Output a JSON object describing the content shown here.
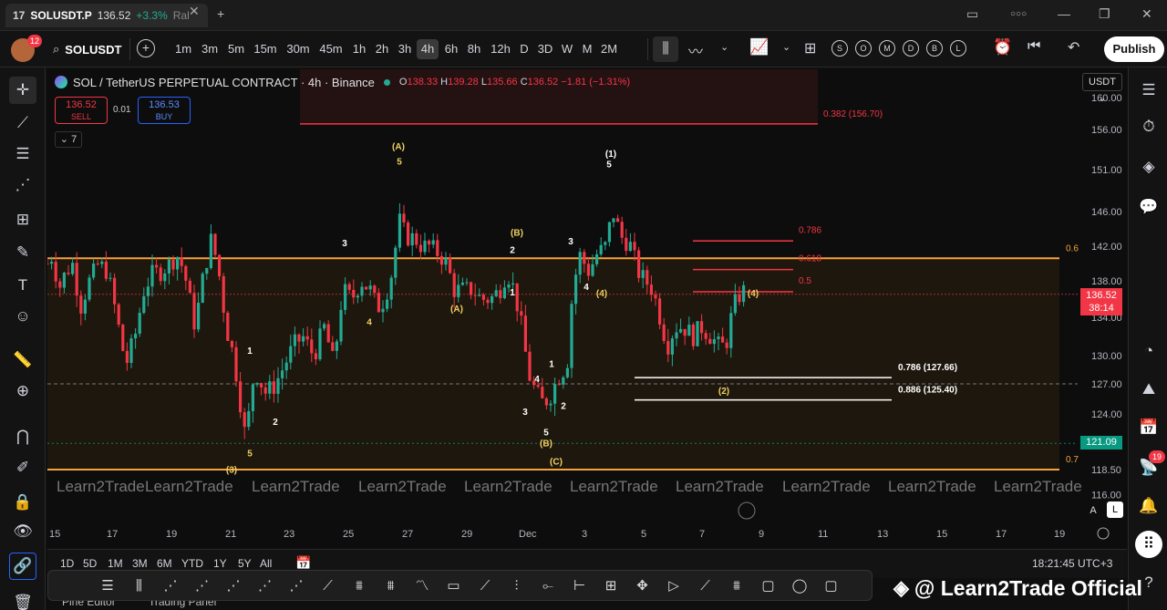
{
  "tab": {
    "symbol": "SOLUSDT.P",
    "price": "136.52",
    "change": "+3.3%",
    "rest": "Ral",
    "close": "✕",
    "new": "+"
  },
  "window": {
    "min": "—",
    "max": "❐",
    "close": "✕",
    "layout": "▭",
    "dots": "○○○"
  },
  "toolbar": {
    "avatar_badge": "12",
    "symbol": "SOLUSDT",
    "intervals": [
      "1m",
      "3m",
      "5m",
      "15m",
      "30m",
      "45m",
      "1h",
      "2h",
      "3h",
      "4h",
      "6h",
      "8h",
      "12h",
      "D",
      "3D",
      "W",
      "M",
      "2M"
    ],
    "active": "4h",
    "sessions": [
      "S",
      "O",
      "M",
      "D",
      "B",
      "L"
    ],
    "publish": "Publish"
  },
  "legend": {
    "title": "SOL / TetherUS PERPETUAL CONTRACT · 4h · Binance",
    "o_label": "O",
    "o": "138.33",
    "h_label": "H",
    "h": "139.28",
    "l_label": "L",
    "l": "135.66",
    "c_label": "C",
    "c": "136.52",
    "chg": "−1.81 (−1.31%)"
  },
  "trade": {
    "sell_price": "136.52",
    "sell": "SELL",
    "spread": "0.01",
    "buy_price": "136.53",
    "buy": "BUY",
    "collapse": "⌄ 7"
  },
  "currency": "USDT ⌄",
  "price_axis": [
    "160.00",
    "156.00",
    "151.00",
    "146.00",
    "142.00",
    "138.00",
    "134.00",
    "130.00",
    "127.00",
    "124.00",
    "121.09",
    "118.50",
    "116.00"
  ],
  "current_price": "136.52",
  "countdown": "38:14",
  "tag_low": "121.09",
  "time_axis": [
    "15",
    "17",
    "19",
    "21",
    "23",
    "25",
    "27",
    "29",
    "Dec",
    "3",
    "5",
    "7",
    "9",
    "11",
    "13",
    "15",
    "17",
    "19"
  ],
  "fib": {
    "f0382": "0.382 (156.70)",
    "f0786": "0.786 (127.66)",
    "f0886": "0.886 (125.40)",
    "r0786": "0.786",
    "r0618": "0.618",
    "r05": "0.5",
    "f06": "0.6",
    "f07": "0.7"
  },
  "waves": {
    "w4": "(4)",
    "w1": "(1)",
    "w2": "(2)",
    "w3": "(3)",
    "A": "(A)",
    "B": "(B)",
    "C": "(C)",
    "n1": "1",
    "n2": "2",
    "n3": "3",
    "n4": "4",
    "n5": "5"
  },
  "brand_wm": "Learn2Trade",
  "bottom": {
    "ranges": [
      "1D",
      "5D",
      "1M",
      "3M",
      "6M",
      "YTD",
      "1Y",
      "5Y",
      "All"
    ],
    "time": "18:21:45 UTC+3",
    "auto_a": "A",
    "auto_l": "L",
    "pine": "Pine Editor",
    "trading": "Trading Panel"
  },
  "right_badge": "19",
  "watermark": "@ Learn2Trade Official"
}
